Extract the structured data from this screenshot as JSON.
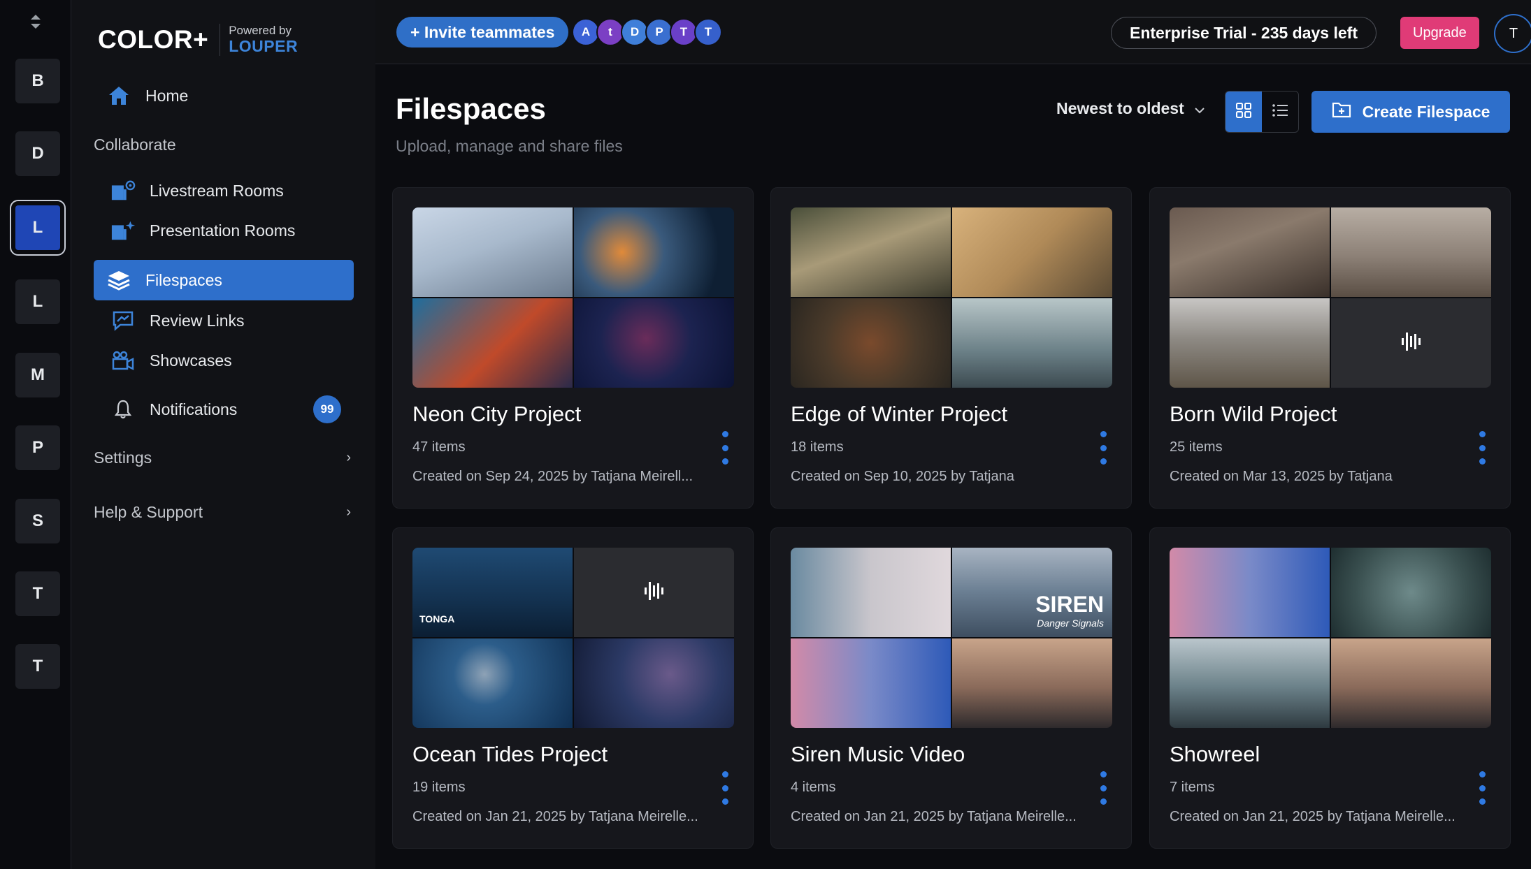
{
  "rail": {
    "workspaces": [
      "B",
      "D",
      "L",
      "L",
      "M",
      "P",
      "S",
      "T",
      "T"
    ]
  },
  "sidebar": {
    "brand": "COLOR+",
    "powered_by": "Powered by",
    "partner": "LOUPER",
    "home": "Home",
    "collaborate": "Collaborate",
    "livestream": "Livestream Rooms",
    "presentation": "Presentation Rooms",
    "filespaces": "Filespaces",
    "review_links": "Review Links",
    "showcases": "Showcases",
    "notifications": "Notifications",
    "notifications_count": "99",
    "settings": "Settings",
    "help": "Help & Support"
  },
  "topbar": {
    "invite": "+ Invite teammates",
    "avatars": [
      "A",
      "t",
      "D",
      "P",
      "T",
      "T"
    ],
    "trial": "Enterprise Trial - 235 days left",
    "upgrade": "Upgrade",
    "user": "T"
  },
  "main": {
    "title": "Filespaces",
    "subtitle": "Upload, manage and share files",
    "sort": "Newest to oldest",
    "create": "Create Filespace"
  },
  "cards": [
    {
      "title": "Neon City Project",
      "count": "47 items",
      "created": "Created on Sep 24, 2025 by Tatjana Meirell..."
    },
    {
      "title": "Edge of Winter Project",
      "count": "18 items",
      "created": "Created on Sep 10, 2025 by Tatjana"
    },
    {
      "title": "Born Wild Project",
      "count": "25 items",
      "created": "Created on Mar 13, 2025 by Tatjana"
    },
    {
      "title": "Ocean Tides Project",
      "count": "19 items",
      "created": "Created on Jan 21, 2025 by Tatjana Meirelle...",
      "overlay": "TONGA"
    },
    {
      "title": "Siren Music Video",
      "count": "4 items",
      "created": "Created on Jan 21, 2025 by Tatjana Meirelle...",
      "overlay": "SIREN",
      "overlay_sub": "Danger Signals"
    },
    {
      "title": "Showreel",
      "count": "7 items",
      "created": "Created on Jan 21, 2025 by Tatjana Meirelle..."
    }
  ],
  "colors": {
    "accent": "#2e6fcb",
    "upgrade": "#e03b77"
  }
}
